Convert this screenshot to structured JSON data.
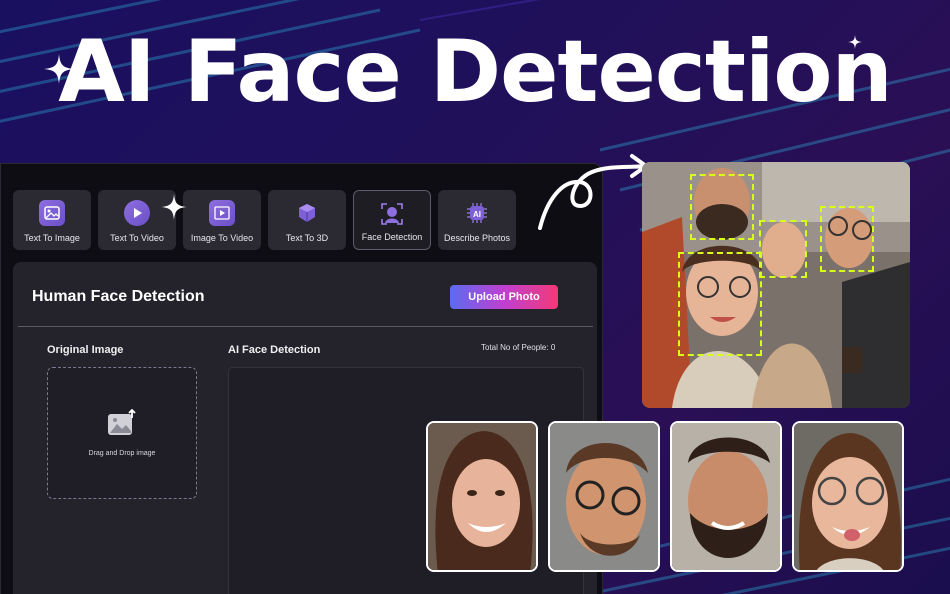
{
  "hero": {
    "title": "AI Face Detection"
  },
  "colors": {
    "accent": "#8e6fe0",
    "detect_box": "#d8ff1a",
    "upload_gradient": [
      "#5b6cf0",
      "#c03fd0",
      "#f23a78"
    ]
  },
  "toolbar": {
    "tools": [
      {
        "label": "Text To Image",
        "icon": "image-icon",
        "active": false
      },
      {
        "label": "Text To Video",
        "icon": "play-icon",
        "active": false
      },
      {
        "label": "Image To Video",
        "icon": "film-icon",
        "active": false
      },
      {
        "label": "Text To 3D",
        "icon": "cube-icon",
        "active": false
      },
      {
        "label": "Face Detection",
        "icon": "face-scan-icon",
        "active": true
      },
      {
        "label": "Describe Photos",
        "icon": "ai-chip-icon",
        "active": false
      }
    ]
  },
  "panel": {
    "title": "Human Face Detection",
    "upload_label": "Upload Photo",
    "original_label": "Original Image",
    "detection_label": "AI Face Detection",
    "count_label": "Total No of People:  0",
    "dropzone_text": "Drag and Drop image"
  }
}
